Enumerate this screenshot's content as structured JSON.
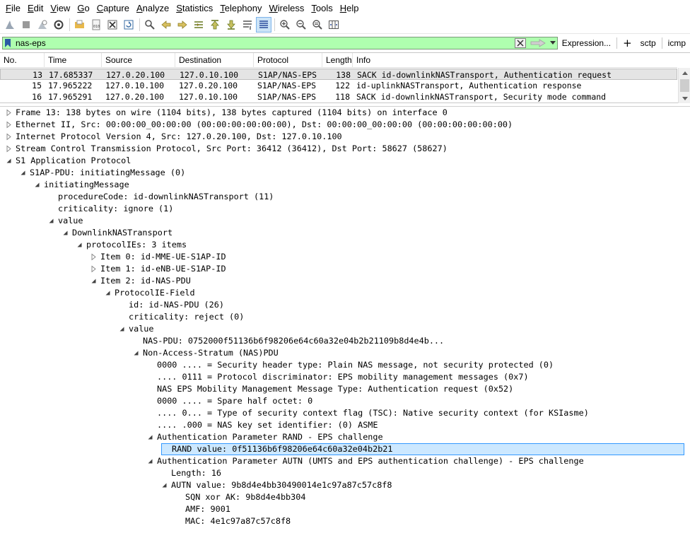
{
  "menu": [
    "File",
    "Edit",
    "View",
    "Go",
    "Capture",
    "Analyze",
    "Statistics",
    "Telephony",
    "Wireless",
    "Tools",
    "Help"
  ],
  "toolbar_icons": [
    "shark-fin-start-icon",
    "stop-capture-icon",
    "restart-capture-icon",
    "capture-options-icon",
    "open-file-icon",
    "save-file-icon",
    "close-file-icon",
    "reload-file-icon",
    "find-packet-icon",
    "go-back-icon",
    "go-forward-icon",
    "go-to-packet-icon",
    "go-first-icon",
    "go-last-icon",
    "auto-scroll-icon",
    "colorize-icon",
    "zoom-in-icon",
    "zoom-out-icon",
    "zoom-normal-icon",
    "resize-columns-icon"
  ],
  "filter": {
    "value": "nas-eps",
    "expression_label": "Expression...",
    "plus_label": "+",
    "buttons": [
      "sctp",
      "icmp"
    ]
  },
  "packet_list": {
    "columns": [
      "No.",
      "Time",
      "Source",
      "Destination",
      "Protocol",
      "Length",
      "Info"
    ],
    "rows": [
      {
        "no": "13",
        "time": "17.685337",
        "src": "127.0.20.100",
        "dst": "127.0.10.100",
        "proto": "S1AP/NAS-EPS",
        "len": "138",
        "info": "SACK id-downlinkNASTransport, Authentication request",
        "selected": true
      },
      {
        "no": "15",
        "time": "17.965222",
        "src": "127.0.10.100",
        "dst": "127.0.20.100",
        "proto": "S1AP/NAS-EPS",
        "len": "122",
        "info": "id-uplinkNASTransport, Authentication response",
        "selected": false
      },
      {
        "no": "16",
        "time": "17.965291",
        "src": "127.0.20.100",
        "dst": "127.0.10.100",
        "proto": "S1AP/NAS-EPS",
        "len": "118",
        "info": "SACK id-downlinkNASTransport, Security mode command",
        "selected": false
      }
    ]
  },
  "details": [
    {
      "depth": 0,
      "arrow": "right",
      "text": "Frame 13: 138 bytes on wire (1104 bits), 138 bytes captured (1104 bits) on interface 0"
    },
    {
      "depth": 0,
      "arrow": "right",
      "text": "Ethernet II, Src: 00:00:00_00:00:00 (00:00:00:00:00:00), Dst: 00:00:00_00:00:00 (00:00:00:00:00:00)"
    },
    {
      "depth": 0,
      "arrow": "right",
      "text": "Internet Protocol Version 4, Src: 127.0.20.100, Dst: 127.0.10.100"
    },
    {
      "depth": 0,
      "arrow": "right",
      "text": "Stream Control Transmission Protocol, Src Port: 36412 (36412), Dst Port: 58627 (58627)"
    },
    {
      "depth": 0,
      "arrow": "down",
      "text": "S1 Application Protocol"
    },
    {
      "depth": 1,
      "arrow": "down",
      "text": "S1AP-PDU: initiatingMessage (0)"
    },
    {
      "depth": 2,
      "arrow": "down",
      "text": "initiatingMessage"
    },
    {
      "depth": 3,
      "arrow": "none",
      "text": "procedureCode: id-downlinkNASTransport (11)"
    },
    {
      "depth": 3,
      "arrow": "none",
      "text": "criticality: ignore (1)"
    },
    {
      "depth": 3,
      "arrow": "down",
      "text": "value"
    },
    {
      "depth": 4,
      "arrow": "down",
      "text": "DownlinkNASTransport"
    },
    {
      "depth": 5,
      "arrow": "down",
      "text": "protocolIEs: 3 items"
    },
    {
      "depth": 6,
      "arrow": "right",
      "text": "Item 0: id-MME-UE-S1AP-ID"
    },
    {
      "depth": 6,
      "arrow": "right",
      "text": "Item 1: id-eNB-UE-S1AP-ID"
    },
    {
      "depth": 6,
      "arrow": "down",
      "text": "Item 2: id-NAS-PDU"
    },
    {
      "depth": 7,
      "arrow": "down",
      "text": "ProtocolIE-Field"
    },
    {
      "depth": 8,
      "arrow": "none",
      "text": "id: id-NAS-PDU (26)"
    },
    {
      "depth": 8,
      "arrow": "none",
      "text": "criticality: reject (0)"
    },
    {
      "depth": 8,
      "arrow": "down",
      "text": "value"
    },
    {
      "depth": 9,
      "arrow": "none",
      "text": "NAS-PDU: 0752000f51136b6f98206e64c60a32e04b2b21109b8d4e4b..."
    },
    {
      "depth": 9,
      "arrow": "down",
      "text": "Non-Access-Stratum (NAS)PDU"
    },
    {
      "depth": 10,
      "arrow": "none",
      "text": "0000 .... = Security header type: Plain NAS message, not security protected (0)"
    },
    {
      "depth": 10,
      "arrow": "none",
      "text": ".... 0111 = Protocol discriminator: EPS mobility management messages (0x7)"
    },
    {
      "depth": 10,
      "arrow": "none",
      "text": "NAS EPS Mobility Management Message Type: Authentication request (0x52)"
    },
    {
      "depth": 10,
      "arrow": "none",
      "text": "0000 .... = Spare half octet: 0"
    },
    {
      "depth": 10,
      "arrow": "none",
      "text": ".... 0... = Type of security context flag (TSC): Native security context (for KSIasme)"
    },
    {
      "depth": 10,
      "arrow": "none",
      "text": ".... .000 = NAS key set identifier:  (0) ASME"
    },
    {
      "depth": 10,
      "arrow": "down",
      "text": "Authentication Parameter RAND - EPS challenge"
    },
    {
      "depth": 11,
      "arrow": "none",
      "text": "RAND value: 0f51136b6f98206e64c60a32e04b2b21",
      "highlight": true
    },
    {
      "depth": 10,
      "arrow": "down",
      "text": "Authentication Parameter AUTN (UMTS and EPS authentication challenge) - EPS challenge"
    },
    {
      "depth": 11,
      "arrow": "none",
      "text": "Length: 16"
    },
    {
      "depth": 11,
      "arrow": "down",
      "text": "AUTN value: 9b8d4e4bb30490014e1c97a87c57c8f8"
    },
    {
      "depth": 12,
      "arrow": "none",
      "text": "SQN xor AK: 9b8d4e4bb304"
    },
    {
      "depth": 12,
      "arrow": "none",
      "text": "AMF: 9001"
    },
    {
      "depth": 12,
      "arrow": "none",
      "text": "MAC: 4e1c97a87c57c8f8"
    }
  ]
}
